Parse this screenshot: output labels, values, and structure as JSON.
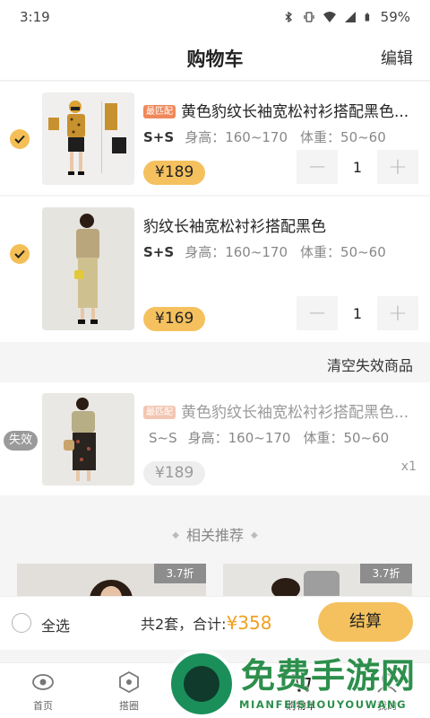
{
  "status_bar": {
    "time": "3:19",
    "battery": "59%"
  },
  "header": {
    "title": "购物车",
    "edit": "编辑"
  },
  "cart": {
    "items": [
      {
        "tag": "最匹配",
        "name": "黄色豹纹长袖宽松衬衫搭配黑色...",
        "size": "S+S",
        "height": "身高：160~170",
        "weight": "体重：50~60",
        "price": "¥189",
        "quantity": "1",
        "checked": true
      },
      {
        "tag": "",
        "name": "豹纹长袖宽松衬衫搭配黑色",
        "size": "S+S",
        "height": "身高：160~170",
        "weight": "体重：50~60",
        "price": "¥169",
        "quantity": "1",
        "checked": true
      }
    ],
    "clear_invalid": "清空失效商品",
    "invalid_items": [
      {
        "badge": "失效",
        "tag": "最匹配",
        "name": "黄色豹纹长袖宽松衬衫搭配黑色...",
        "size": "S~S",
        "height": "身高：160~170",
        "weight": "体重：50~60",
        "price": "¥189",
        "quantity": "x1"
      }
    ]
  },
  "recommend": {
    "title": "相关推荐",
    "cards": [
      {
        "discount": "3.7折"
      },
      {
        "discount": "3.7折"
      }
    ]
  },
  "checkout": {
    "select_all": "全选",
    "summary_prefix": "共2套，合计:",
    "total": "¥358",
    "pay": "结算"
  },
  "tabs": [
    {
      "label": "首页",
      "icon": "eye-icon"
    },
    {
      "label": "搭圈",
      "icon": "hexagon-icon"
    },
    {
      "label": "购物车",
      "icon": "cart-icon"
    },
    {
      "label": "我的",
      "icon": "user-icon"
    }
  ],
  "watermark": {
    "title": "免费手游网",
    "subtitle": "MIANFEISHOUYOUWANG"
  },
  "colors": {
    "accent": "#f5c15e",
    "price_orange": "#f0a020",
    "tag": "#f0885a"
  }
}
